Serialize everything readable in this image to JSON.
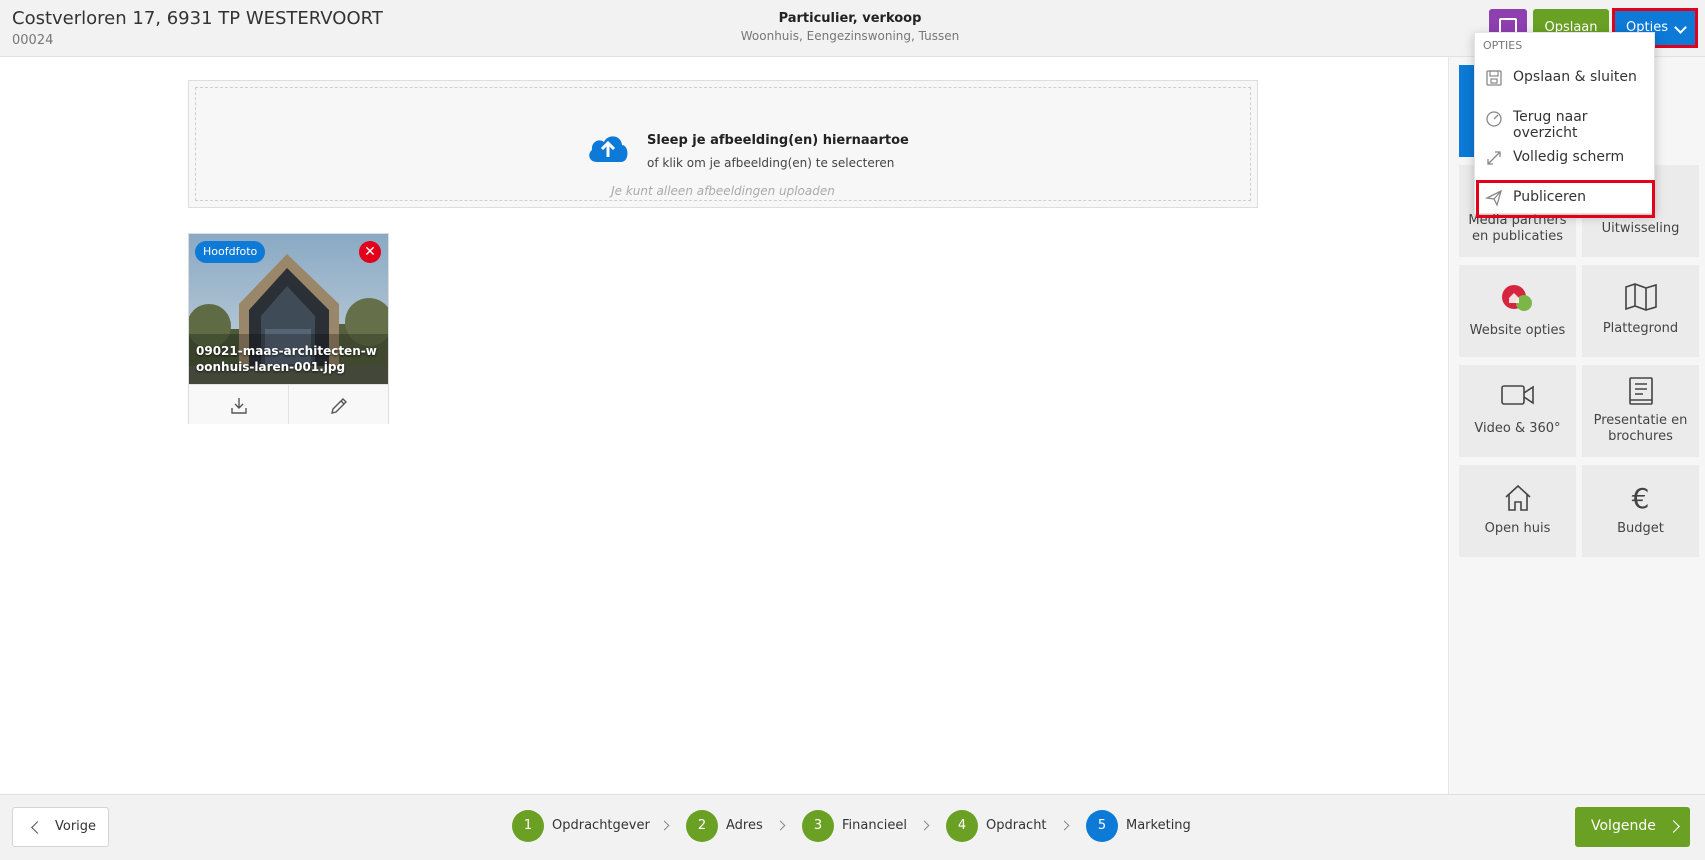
{
  "header": {
    "title": "Costverloren 17, 6931 TP WESTERVOORT",
    "code": "00024",
    "type": "Particulier, verkoop",
    "subtype": "Woonhuis, Eengezinswoning, Tussen",
    "save_label": "Opslaan",
    "options_label": "Opties"
  },
  "dropdown": {
    "heading": "OPTIES",
    "items": [
      {
        "label": "Opslaan & sluiten",
        "icon": "save-icon"
      },
      {
        "label": "Terug naar overzicht",
        "icon": "dashboard-icon"
      },
      {
        "label": "Volledig scherm",
        "icon": "expand-icon"
      },
      {
        "label": "Publiceren",
        "icon": "paper-plane-icon"
      }
    ]
  },
  "tiles": [
    {
      "label": "Media partners en publicaties",
      "icon": "media-icon"
    },
    {
      "label": "Uitwisseling",
      "icon": "exchange-icon"
    },
    {
      "label": "Website opties",
      "icon": "website-icon"
    },
    {
      "label": "Plattegrond",
      "icon": "map-icon"
    },
    {
      "label": "Video & 360°",
      "icon": "video-icon"
    },
    {
      "label": "Presentatie en brochures",
      "icon": "brochure-icon"
    },
    {
      "label": "Open huis",
      "icon": "house-icon"
    },
    {
      "label": "Budget",
      "icon": "euro-icon"
    }
  ],
  "upload": {
    "main": "Sleep je afbeelding(en) hiernaartoe",
    "sub": "of klik om je afbeelding(en) te selecteren",
    "note": "Je kunt alleen afbeeldingen uploaden"
  },
  "photo": {
    "badge": "Hoofdfoto",
    "filename": "09021-maas-architecten-woonhuis-laren-001.jpg"
  },
  "footer": {
    "prev_label": "Vorige",
    "next_label": "Volgende",
    "steps": [
      {
        "num": "1",
        "label": "Opdrachtgever",
        "state": "done"
      },
      {
        "num": "2",
        "label": "Adres",
        "state": "done"
      },
      {
        "num": "3",
        "label": "Financieel",
        "state": "done"
      },
      {
        "num": "4",
        "label": "Opdracht",
        "state": "done"
      },
      {
        "num": "5",
        "label": "Marketing",
        "state": "active"
      }
    ]
  },
  "colors": {
    "accent_blue": "#0c7ad6",
    "accent_green": "#6aa024",
    "purple": "#8e3fb0",
    "highlight_red": "#e2001a"
  }
}
